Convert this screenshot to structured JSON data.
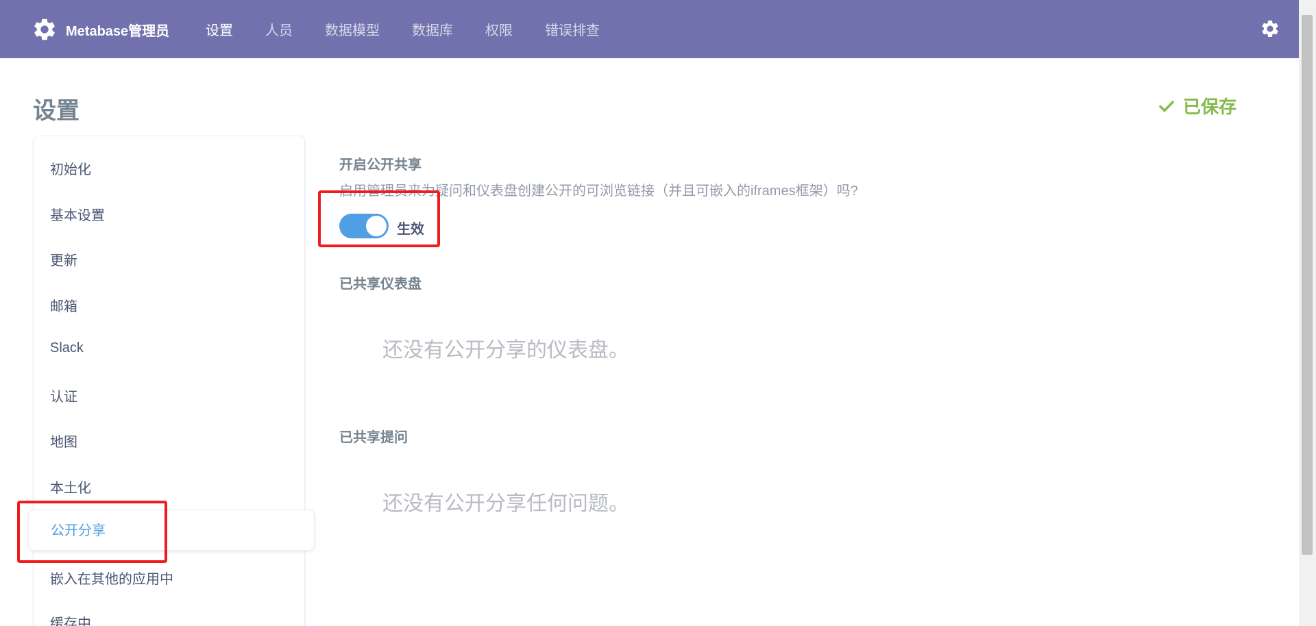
{
  "topbar": {
    "brand": "Metabase管理员",
    "nav": [
      "设置",
      "人员",
      "数据模型",
      "数据库",
      "权限",
      "错误排查"
    ],
    "active_index": 0,
    "background": "#7172ad"
  },
  "page": {
    "title": "设置",
    "saved_label": "已保存"
  },
  "sidebar": {
    "items": [
      "初始化",
      "基本设置",
      "更新",
      "邮箱",
      "Slack",
      "认证",
      "地图",
      "本土化",
      "公开分享",
      "嵌入在其他的应用中",
      "缓存中"
    ],
    "active_index": 8
  },
  "content": {
    "public_sharing": {
      "title": "开启公开共享",
      "description": "启用管理员来为疑问和仪表盘创建公开的可浏览链接（并且可嵌入的iframes框架）吗?",
      "toggle_on": true,
      "toggle_label": "生效"
    },
    "shared_dashboards": {
      "title": "已共享仪表盘",
      "empty_text": "还没有公开分享的仪表盘。"
    },
    "shared_questions": {
      "title": "已共享提问",
      "empty_text": "还没有公开分享任何问题。"
    }
  },
  "colors": {
    "accent": "#509ee3",
    "saved": "#84bb4c",
    "highlight": "#ee1c1c"
  }
}
